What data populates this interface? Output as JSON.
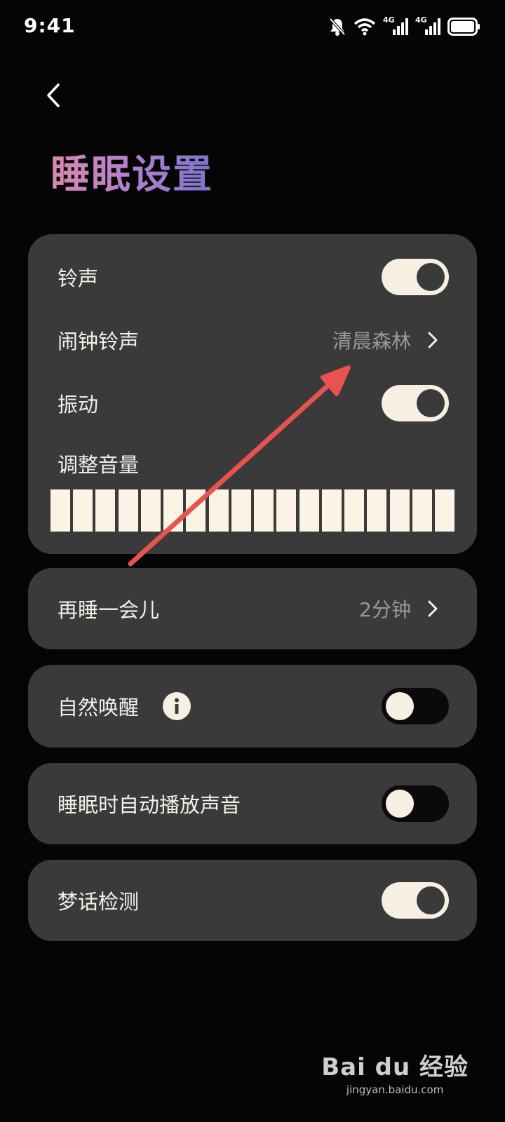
{
  "status_bar": {
    "time": "9:41",
    "network_1": "4G",
    "network_2": "4G"
  },
  "header": {
    "title": "睡眠设置"
  },
  "ringtone_card": {
    "ringtone": {
      "label": "铃声",
      "enabled": true
    },
    "alarm_ringtone": {
      "label": "闹钟铃声",
      "value": "清晨森林"
    },
    "vibration": {
      "label": "振动",
      "enabled": true
    },
    "volume": {
      "label": "调整音量",
      "level": 1.0
    }
  },
  "snooze": {
    "label": "再睡一会儿",
    "value": "2分钟"
  },
  "natural_wake": {
    "label": "自然唤醒",
    "enabled": false
  },
  "auto_play_sound": {
    "label": "睡眠时自动播放声音",
    "enabled": false
  },
  "sleep_talk_detection": {
    "label": "梦话检测",
    "enabled": true
  },
  "watermark": {
    "logo": "Bai du 经验",
    "url": "jingyan.baidu.com"
  },
  "colors": {
    "card": "#3a3a3a",
    "toggle_on": "#f6efe2",
    "annotation_arrow": "#e8524f"
  }
}
